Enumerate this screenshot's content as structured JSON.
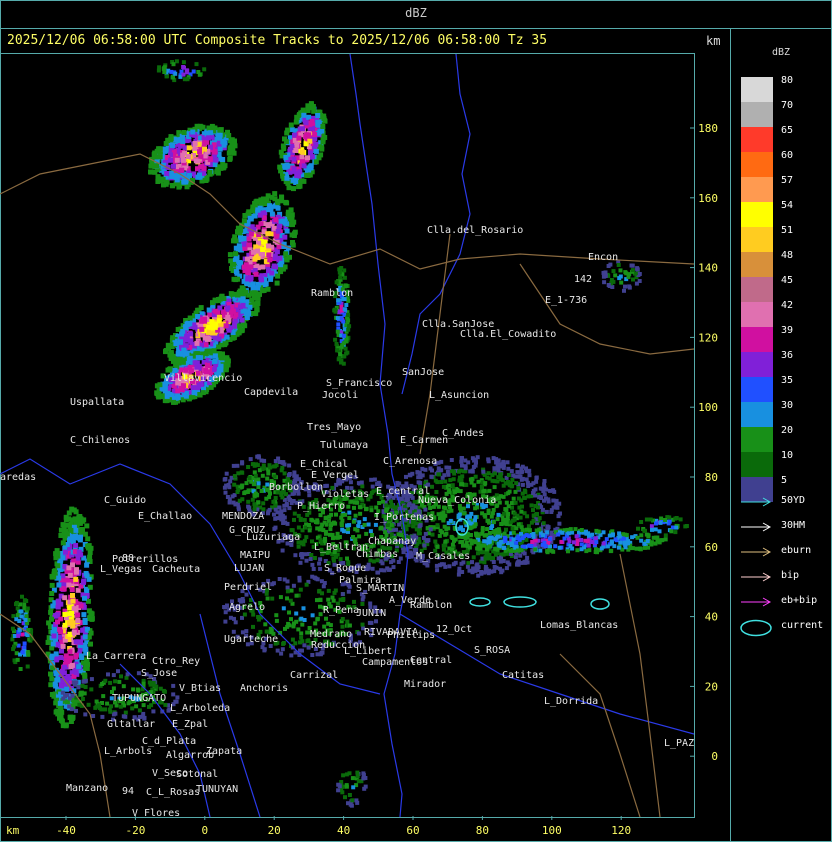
{
  "header": {
    "product": "dBZ",
    "km_label": "km"
  },
  "title": "2025/12/06 06:58:00 UTC Composite Tracks to 2025/12/06 06:58:00 Tz 35",
  "axes": {
    "y_ticks": [
      "180",
      "160",
      "140",
      "120",
      "100",
      "80",
      "60",
      "40",
      "20",
      "0"
    ],
    "x_ticks": [
      "-40",
      "-20",
      "0",
      "20",
      "40",
      "60",
      "80",
      "100",
      "120"
    ],
    "km_label": "km"
  },
  "legend": {
    "title": "dBZ",
    "levels": [
      {
        "label": "80",
        "color": "#d8d8d8"
      },
      {
        "label": "70",
        "color": "#b0b0b0"
      },
      {
        "label": "65",
        "color": "#ff3a2a"
      },
      {
        "label": "60",
        "color": "#ff6a12"
      },
      {
        "label": "57",
        "color": "#ff9a50"
      },
      {
        "label": "54",
        "color": "#ffff00"
      },
      {
        "label": "51",
        "color": "#ffcc20"
      },
      {
        "label": "48",
        "color": "#d8903a"
      },
      {
        "label": "45",
        "color": "#c06a8a"
      },
      {
        "label": "42",
        "color": "#e070b0"
      },
      {
        "label": "39",
        "color": "#d010a0"
      },
      {
        "label": "36",
        "color": "#8020d8"
      },
      {
        "label": "35",
        "color": "#2050ff"
      },
      {
        "label": "30",
        "color": "#1890e0"
      },
      {
        "label": "20",
        "color": "#189018"
      },
      {
        "label": "10",
        "color": "#0a6a0a"
      },
      {
        "label": "5",
        "color": "#404090"
      }
    ],
    "tracks": [
      {
        "label": "50YD",
        "color": "#40e0e0"
      },
      {
        "label": "30HM",
        "color": "#ffffff"
      },
      {
        "label": "eburn",
        "color": "#e0c080"
      },
      {
        "label": "bip",
        "color": "#ffd0d0"
      },
      {
        "label": "eb+bip",
        "color": "#ff40ff"
      }
    ],
    "current": {
      "label": "current",
      "color": "#40e0e0"
    }
  },
  "places": [
    {
      "name": "Clla.del_Rosario"
    },
    {
      "name": "Encon"
    },
    {
      "name": "E_1-736"
    },
    {
      "name": "142"
    },
    {
      "name": "Ramblon"
    },
    {
      "name": "Clla.SanJose"
    },
    {
      "name": "Clla.El_Cowadito"
    },
    {
      "name": "Uspallata"
    },
    {
      "name": "Villavicencio"
    },
    {
      "name": "Capdevila"
    },
    {
      "name": "S_Francisco"
    },
    {
      "name": "Jocoli"
    },
    {
      "name": "SanJose"
    },
    {
      "name": "L_Asuncion"
    },
    {
      "name": "C_Chilenos"
    },
    {
      "name": "Tres_Mayo"
    },
    {
      "name": "Tulumaya"
    },
    {
      "name": "E_Carmen"
    },
    {
      "name": "C_Andes"
    },
    {
      "name": "aredas"
    },
    {
      "name": "E_Chical"
    },
    {
      "name": "E_Vergel"
    },
    {
      "name": "C_Arenosa"
    },
    {
      "name": "Borbollon"
    },
    {
      "name": "Violetas"
    },
    {
      "name": "E_central"
    },
    {
      "name": "C_Guido"
    },
    {
      "name": "P_Hierro"
    },
    {
      "name": "Nueva_Colonia"
    },
    {
      "name": "E_Challao"
    },
    {
      "name": "MENDOZA"
    },
    {
      "name": "I_Portenas"
    },
    {
      "name": "G_CRUZ"
    },
    {
      "name": "Luzuriaga"
    },
    {
      "name": "L_Beltran"
    },
    {
      "name": "Chapanay"
    },
    {
      "name": "Potrerillos"
    },
    {
      "name": "MAIPU"
    },
    {
      "name": "Chimbas"
    },
    {
      "name": "M_Casales"
    },
    {
      "name": "L_Vegas"
    },
    {
      "name": "Cacheuta"
    },
    {
      "name": "LUJAN"
    },
    {
      "name": "S_Roque"
    },
    {
      "name": "Palmira"
    },
    {
      "name": "Perdriel"
    },
    {
      "name": "S_MARTIN"
    },
    {
      "name": "A_Verde"
    },
    {
      "name": "Agrelo"
    },
    {
      "name": "R_Pena"
    },
    {
      "name": "JUNIN"
    },
    {
      "name": "Ramblon"
    },
    {
      "name": "Lomas_Blancas"
    },
    {
      "name": "Ugarteche"
    },
    {
      "name": "Medrano"
    },
    {
      "name": "RIVADAVIA"
    },
    {
      "name": "Phillips"
    },
    {
      "name": "12_Oct"
    },
    {
      "name": "La_Carrera"
    },
    {
      "name": "Reduccion"
    },
    {
      "name": "L_Libert"
    },
    {
      "name": "Ctro_Rey"
    },
    {
      "name": "S_Jose"
    },
    {
      "name": "Campamentos"
    },
    {
      "name": "Central"
    },
    {
      "name": "S_ROSA"
    },
    {
      "name": "Catitas"
    },
    {
      "name": "Carrizal"
    },
    {
      "name": "Mirador"
    },
    {
      "name": "V_Btias"
    },
    {
      "name": "Anchoris"
    },
    {
      "name": "TUPUNGATO"
    },
    {
      "name": "L_Dorrida"
    },
    {
      "name": "L_Arboleda"
    },
    {
      "name": "Gltallar"
    },
    {
      "name": "E_Zpal"
    },
    {
      "name": "C_d_Plata"
    },
    {
      "name": "L_Arbols"
    },
    {
      "name": "Algarrob"
    },
    {
      "name": "Zapata"
    },
    {
      "name": "V_Seco"
    },
    {
      "name": "Sotonal"
    },
    {
      "name": "L_PAZ"
    },
    {
      "name": "TUNUYAN"
    },
    {
      "name": "Manzano"
    },
    {
      "name": "94"
    },
    {
      "name": "C_L_Rosas"
    },
    {
      "name": "V_Flores"
    },
    {
      "name": "88"
    }
  ]
}
